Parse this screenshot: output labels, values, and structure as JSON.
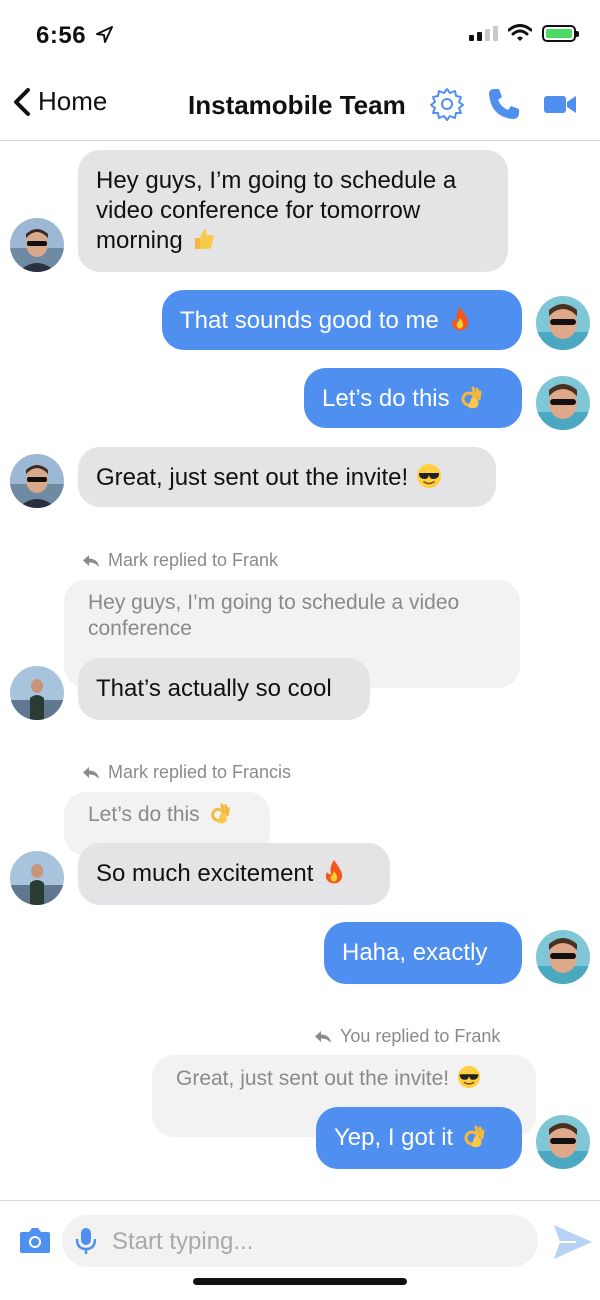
{
  "status_bar": {
    "time": "6:56"
  },
  "nav": {
    "back_label": "Home",
    "title": "Instamobile Team"
  },
  "messages": {
    "m1": "Hey guys, I’m going to schedule a video conference for tomorrow morning",
    "m2": "That sounds good to me",
    "m3": "Let’s do this",
    "m4": "Great, just sent out the invite!",
    "r1_label": "Mark replied to Frank",
    "r1_quote": "Hey guys, I’m going to schedule a video conference",
    "r1_text": "That’s actually so cool",
    "r2_label": "Mark replied to Francis",
    "r2_quote": "Let’s do this",
    "r2_text": "So much excitement",
    "m5": "Haha, exactly",
    "r3_label": "You replied to Frank",
    "r3_quote": "Great, just sent out the invite!",
    "r3_text": "Yep, I got it"
  },
  "composer": {
    "placeholder": "Start typing..."
  },
  "colors": {
    "accent": "#4f8ff0",
    "incoming_bubble": "#e4e4e6",
    "quote_bubble": "#f2f2f2"
  },
  "icons": [
    "location-arrow-icon",
    "signal-icon",
    "wifi-icon",
    "battery-icon",
    "chevron-left-icon",
    "gear-icon",
    "phone-icon",
    "video-camera-icon",
    "thumbs-up-emoji",
    "fire-emoji",
    "ok-hand-emoji",
    "sunglasses-emoji",
    "reply-arrow-icon",
    "camera-icon",
    "microphone-icon",
    "send-icon"
  ]
}
